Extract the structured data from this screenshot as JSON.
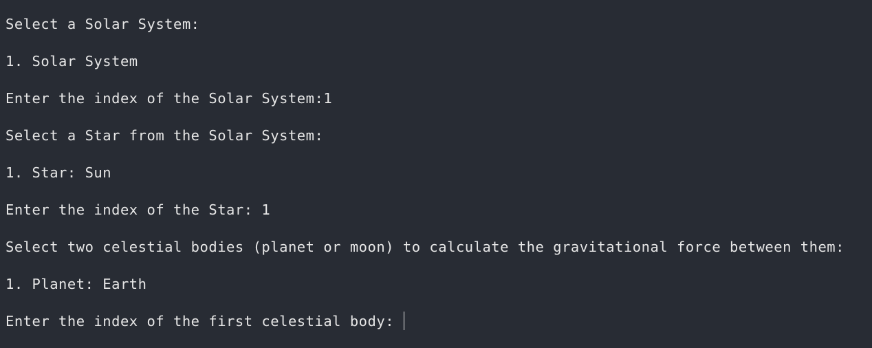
{
  "terminal": {
    "lines": [
      "Select a Solar System:",
      "1. Solar System",
      "Enter the index of the Solar System:1",
      "Select a Star from the Solar System:",
      "1. Star: Sun",
      "Enter the index of the Star: 1",
      "Select two celestial bodies (planet or moon) to calculate the gravitational force between them:",
      "1. Planet: Earth"
    ],
    "prompt": "Enter the index of the first celestial body: "
  },
  "colors": {
    "background": "#282c34",
    "foreground": "#e6e6e6"
  }
}
